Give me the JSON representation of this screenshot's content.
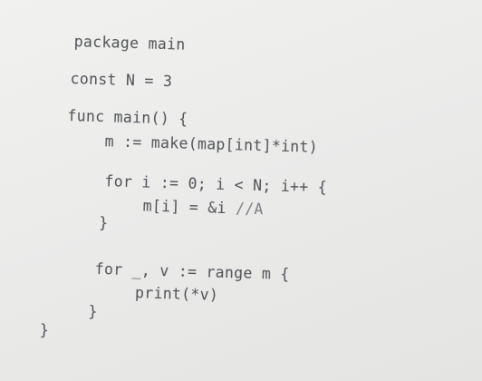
{
  "code": {
    "lines": [
      "package main",
      "const N = 3",
      "func main() {",
      "m := make(map[int]*int)",
      "for i := 0; i < N; i++ {",
      "m[i] = &i",
      "}",
      "for _, v := range m {",
      "print(*v)",
      "}",
      "}"
    ],
    "comment_a": "//A"
  }
}
